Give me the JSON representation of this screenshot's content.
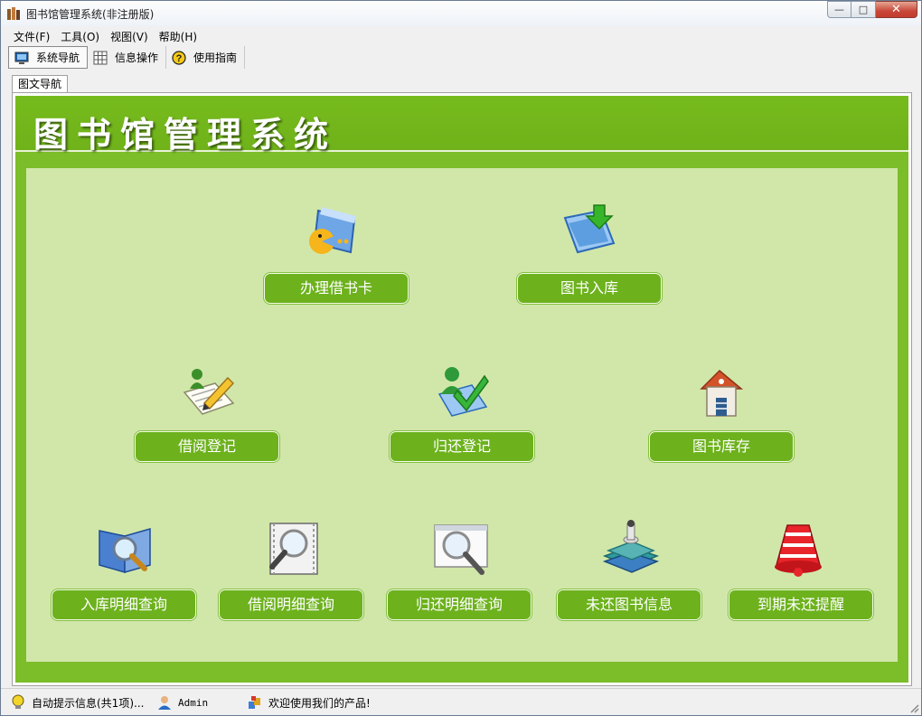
{
  "window": {
    "title": "图书馆管理系统(非注册版)",
    "min_glyph": "—",
    "max_glyph": "□",
    "close_glyph": "✕"
  },
  "menu": [
    "文件(F)",
    "工具(O)",
    "视图(V)",
    "帮助(H)"
  ],
  "toolbar": [
    {
      "label": "系统导航",
      "icon": "monitor-icon"
    },
    {
      "label": "信息操作",
      "icon": "grid-icon"
    },
    {
      "label": "使用指南",
      "icon": "help-icon"
    }
  ],
  "tab": "图文导航",
  "header": {
    "title": "图书馆管理系统"
  },
  "functions": {
    "card": "办理借书卡",
    "stock_in": "图书入库",
    "borrow": "借阅登记",
    "return": "归还登记",
    "inventory": "图书库存",
    "stock_in_query": "入库明细查询",
    "borrow_query": "借阅明细查询",
    "return_query": "归还明细查询",
    "unreturned": "未还图书信息",
    "overdue": "到期未还提醒"
  },
  "status": {
    "hint": "自动提示信息(共1项)...",
    "user": "Admin",
    "welcome": "欢迎使用我们的产品!"
  },
  "colors": {
    "header_green": "#76bb1d",
    "frame_green": "#7cbd2a",
    "content_green": "#d1e7a9",
    "button_green": "#6db21d"
  }
}
